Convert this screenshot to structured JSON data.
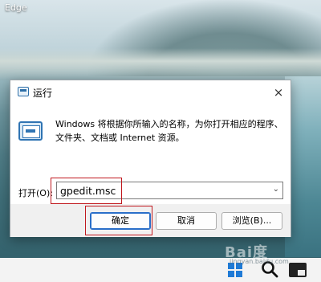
{
  "desktop": {
    "label": "Edge"
  },
  "run_dialog": {
    "title": "运行",
    "close_glyph": "×",
    "description": "Windows 将根据你所输入的名称，为你打开相应的程序、文件夹、文档或 Internet 资源。",
    "open_label": "打开(O):",
    "input_value": "gpedit.msc",
    "ok_label": "确定",
    "cancel_label": "取消",
    "browse_label": "浏览(B)..."
  },
  "watermark": {
    "text": "Bai度",
    "sub": "jingyan.baidu.com"
  },
  "colors": {
    "highlight": "#c0181e",
    "accent": "#2a6fc9"
  },
  "icons": [
    "run-icon",
    "close-icon",
    "run-large-icon",
    "chevron-down-icon",
    "windows-start-icon",
    "search-icon",
    "taskbar-app-icon"
  ]
}
